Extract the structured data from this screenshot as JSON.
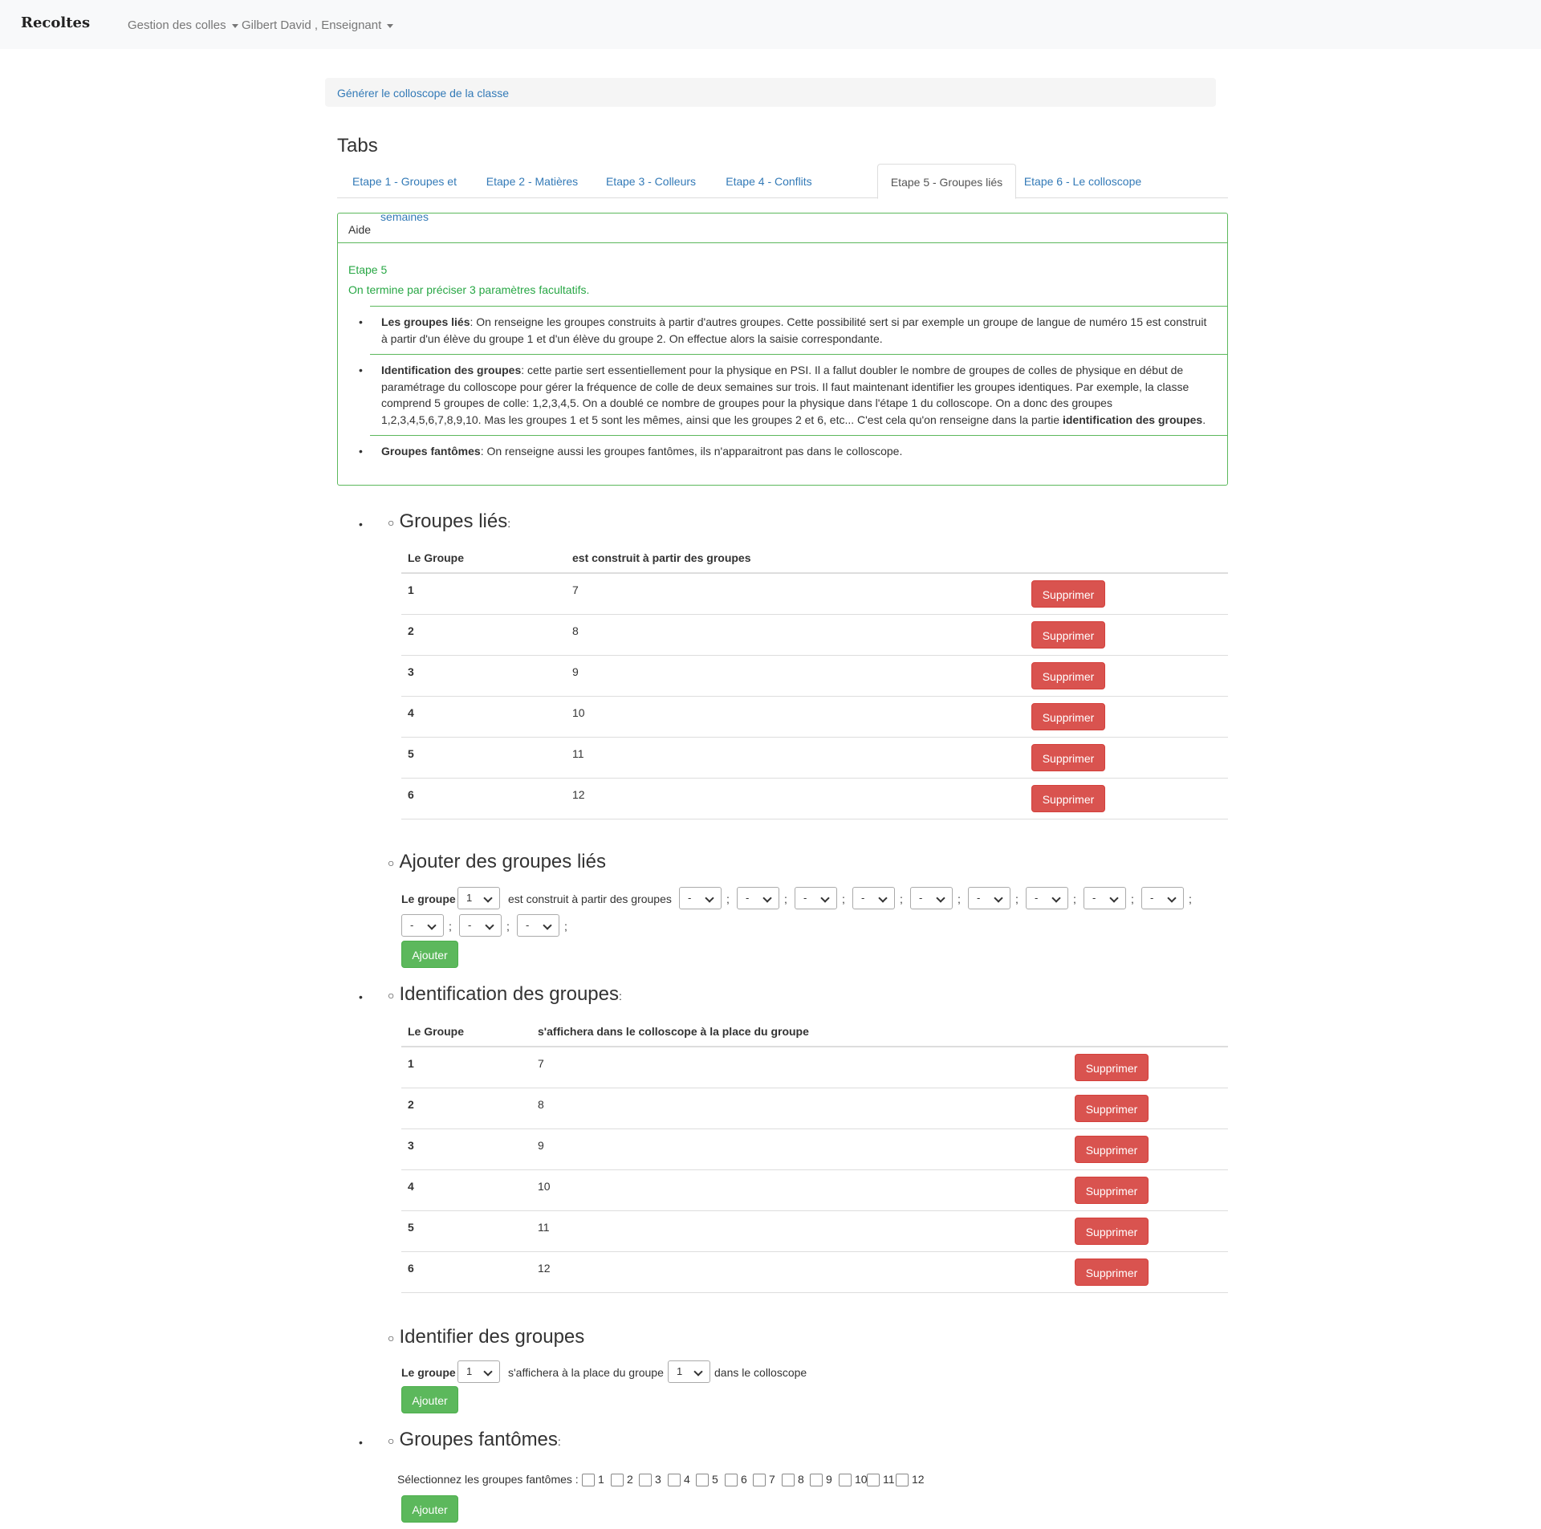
{
  "navbar": {
    "brand": "Recoltes",
    "menu1": "Gestion des colles",
    "menu2": "Gilbert David , Enseignant"
  },
  "generate_link": "Générer le colloscope de la classe",
  "tabs_title": "Tabs",
  "tabs": [
    "Etape 1 - Groupes et semaines",
    "Etape 2 - Matières",
    "Etape 3 - Colleurs",
    "Etape 4 - Conflits",
    "Etape 5 - Groupes liés",
    "Etape 6 - Le colloscope"
  ],
  "aide": {
    "title": "Aide",
    "etape": "Etape 5",
    "subtitle": "On termine par préciser 3 paramètres facultatifs.",
    "item1_bold": "Les groupes liés",
    "item1_text": ": On renseigne les groupes construits à partir d'autres groupes. Cette possibilité sert si par exemple un groupe de langue de numéro 15 est construit à partir d'un élève du groupe 1 et d'un élève du groupe 2. On effectue alors la saisie correspondante.",
    "item2_bold": "Identification des groupes",
    "item2_text": ": cette partie sert essentiellement pour la physique en PSI. Il a fallut doubler le nombre de groupes de colles de physique en début de paramétrage du colloscope pour gérer la fréquence de colle de deux semaines sur trois. Il faut maintenant identifier les groupes identiques. Par exemple, la classe comprend 5 groupes de colle: 1,2,3,4,5. On a doublé ce nombre de groupes pour la physique dans l'étape 1 du colloscope. On a donc des groupes 1,2,3,4,5,6,7,8,9,10. Mas les groupes 1 et 5 sont les mêmes, ainsi que les groupes 2 et 6, etc... C'est cela qu'on renseigne dans la partie ",
    "item2_bold2": "identification des groupes",
    "item2_end": ".",
    "item3_bold": "Groupes fantômes",
    "item3_text": ": On renseigne aussi les groupes fantômes, ils n'apparaitront pas dans le colloscope."
  },
  "groupes_lies": {
    "title": "Groupes liés",
    "colon": ":",
    "col1": "Le Groupe",
    "col2": "est construit à partir des groupes",
    "rows": [
      {
        "groupe": "1",
        "value": "7"
      },
      {
        "groupe": "2",
        "value": "8"
      },
      {
        "groupe": "3",
        "value": "9"
      },
      {
        "groupe": "4",
        "value": "10"
      },
      {
        "groupe": "5",
        "value": "11"
      },
      {
        "groupe": "6",
        "value": "12"
      }
    ],
    "delete_label": "Supprimer"
  },
  "ajouter_lies": {
    "title": "Ajouter des groupes liés",
    "label": "Le groupe",
    "selected_groupe": "1",
    "middle_text": "est construit à partir des groupes",
    "dash": "-",
    "sep": ";",
    "button": "Ajouter"
  },
  "identification": {
    "title": "Identification des groupes",
    "colon": ":",
    "col1": "Le Groupe",
    "col2": "s'affichera dans le colloscope à la place du groupe",
    "rows": [
      {
        "groupe": "1",
        "value": "7"
      },
      {
        "groupe": "2",
        "value": "8"
      },
      {
        "groupe": "3",
        "value": "9"
      },
      {
        "groupe": "4",
        "value": "10"
      },
      {
        "groupe": "5",
        "value": "11"
      },
      {
        "groupe": "6",
        "value": "12"
      }
    ],
    "delete_label": "Supprimer"
  },
  "identifier": {
    "title": "Identifier des groupes",
    "label": "Le groupe",
    "sel1": "1",
    "middle_text": "s'affichera à la place du groupe",
    "sel2": "1",
    "end_text": "dans le colloscope",
    "button": "Ajouter"
  },
  "fantomes": {
    "title": "Groupes fantômes",
    "colon": ":",
    "label": "Sélectionnez les groupes fantômes :",
    "options": [
      "1",
      "2",
      "3",
      "4",
      "5",
      "6",
      "7",
      "8",
      "9",
      "10",
      "11",
      "12"
    ],
    "button": "Ajouter"
  },
  "colors": {
    "accent": "#337ab7",
    "danger": "#d9534f",
    "success": "#5cb85c",
    "help_border": "#5cb85c",
    "help_text": "#28a745"
  }
}
